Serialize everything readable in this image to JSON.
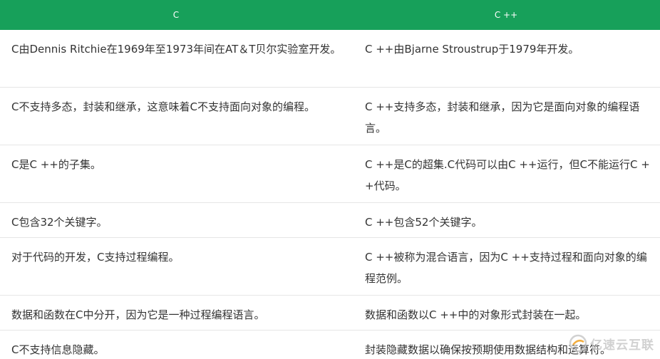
{
  "table": {
    "headers": [
      "C",
      "C ++"
    ],
    "rows": [
      [
        "C由Dennis Ritchie在1969年至1973年间在AT＆T贝尔实验室开发。",
        "C ++由Bjarne Stroustrup于1979年开发。"
      ],
      [
        "C不支持多态，封装和继承，这意味着C不支持面向对象的编程。",
        "C ++支持多态，封装和继承，因为它是面向对象的编程语言。"
      ],
      [
        "C是C ++的子集。",
        "C ++是C的超集.C代码可以由C ++运行，但C不能运行C ++代码。"
      ],
      [
        "C包含32个关键字。",
        "C ++包含52个关键字。"
      ],
      [
        "对于代码的开发，C支持过程编程。",
        "C ++被称为混合语言，因为C ++支持过程和面向对象的编程范例。"
      ],
      [
        "数据和函数在C中分开，因为它是一种过程编程语言。",
        "数据和函数以C ++中的对象形式封装在一起。"
      ],
      [
        "C不支持信息隐藏。",
        "封装隐藏数据以确保按预期使用数据结构和运算符。"
      ]
    ]
  },
  "watermark": {
    "text": "亿速云互联",
    "icon": "brand-logo-icon",
    "color": "#c9c9c9",
    "accent": "#f0a020"
  },
  "colors": {
    "header_bg": "#17a05a",
    "header_text": "#ffffff",
    "body_text": "#333333",
    "row_border": "#e6e6e6"
  }
}
